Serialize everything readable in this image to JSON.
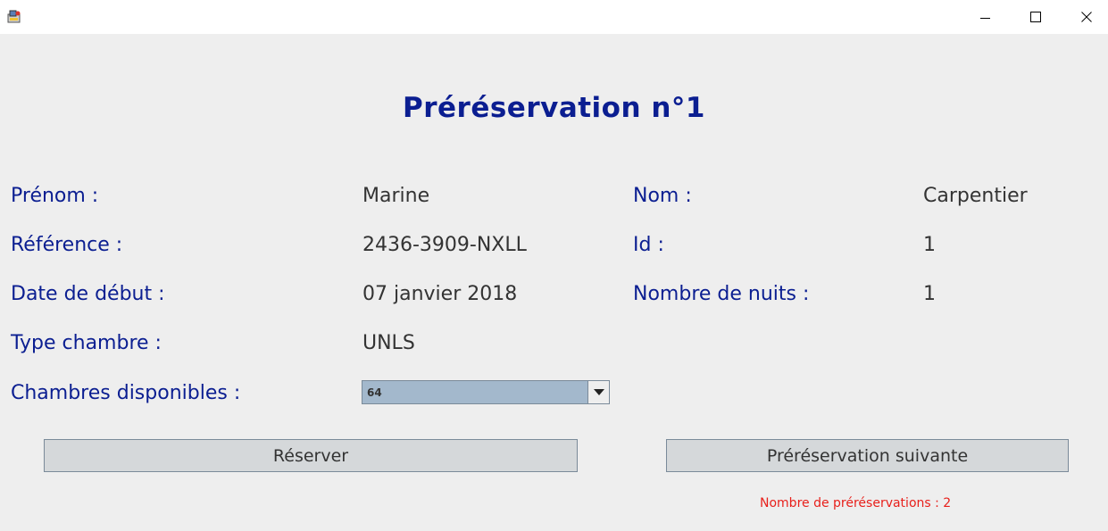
{
  "window": {
    "controls": {
      "minimize_icon": "minimize-icon",
      "maximize_icon": "maximize-icon",
      "close_icon": "close-icon"
    }
  },
  "title": "Préréservation n°1",
  "fields": {
    "prenom": {
      "label": "Prénom :",
      "value": "Marine"
    },
    "nom": {
      "label": "Nom :",
      "value": "Carpentier"
    },
    "reference": {
      "label": "Référence :",
      "value": "2436-3909-NXLL"
    },
    "id": {
      "label": "Id :",
      "value": "1"
    },
    "date_debut": {
      "label": "Date de début :",
      "value": "07 janvier 2018"
    },
    "nombre_nuits": {
      "label": "Nombre de nuits :",
      "value": "1"
    },
    "type_chambre": {
      "label": "Type chambre :",
      "value": "UNLS"
    },
    "chambres_disponibles": {
      "label": "Chambres disponibles :",
      "selected": "64"
    }
  },
  "buttons": {
    "reserver": "Réserver",
    "suivante": "Préréservation suivante"
  },
  "status": {
    "count_text": "Nombre de préréservations : 2"
  },
  "colors": {
    "label": "#0b1e91",
    "value": "#333333",
    "status": "#e8201b",
    "combo_bg": "#a3b8cc",
    "button_bg": "#d5d8da"
  }
}
